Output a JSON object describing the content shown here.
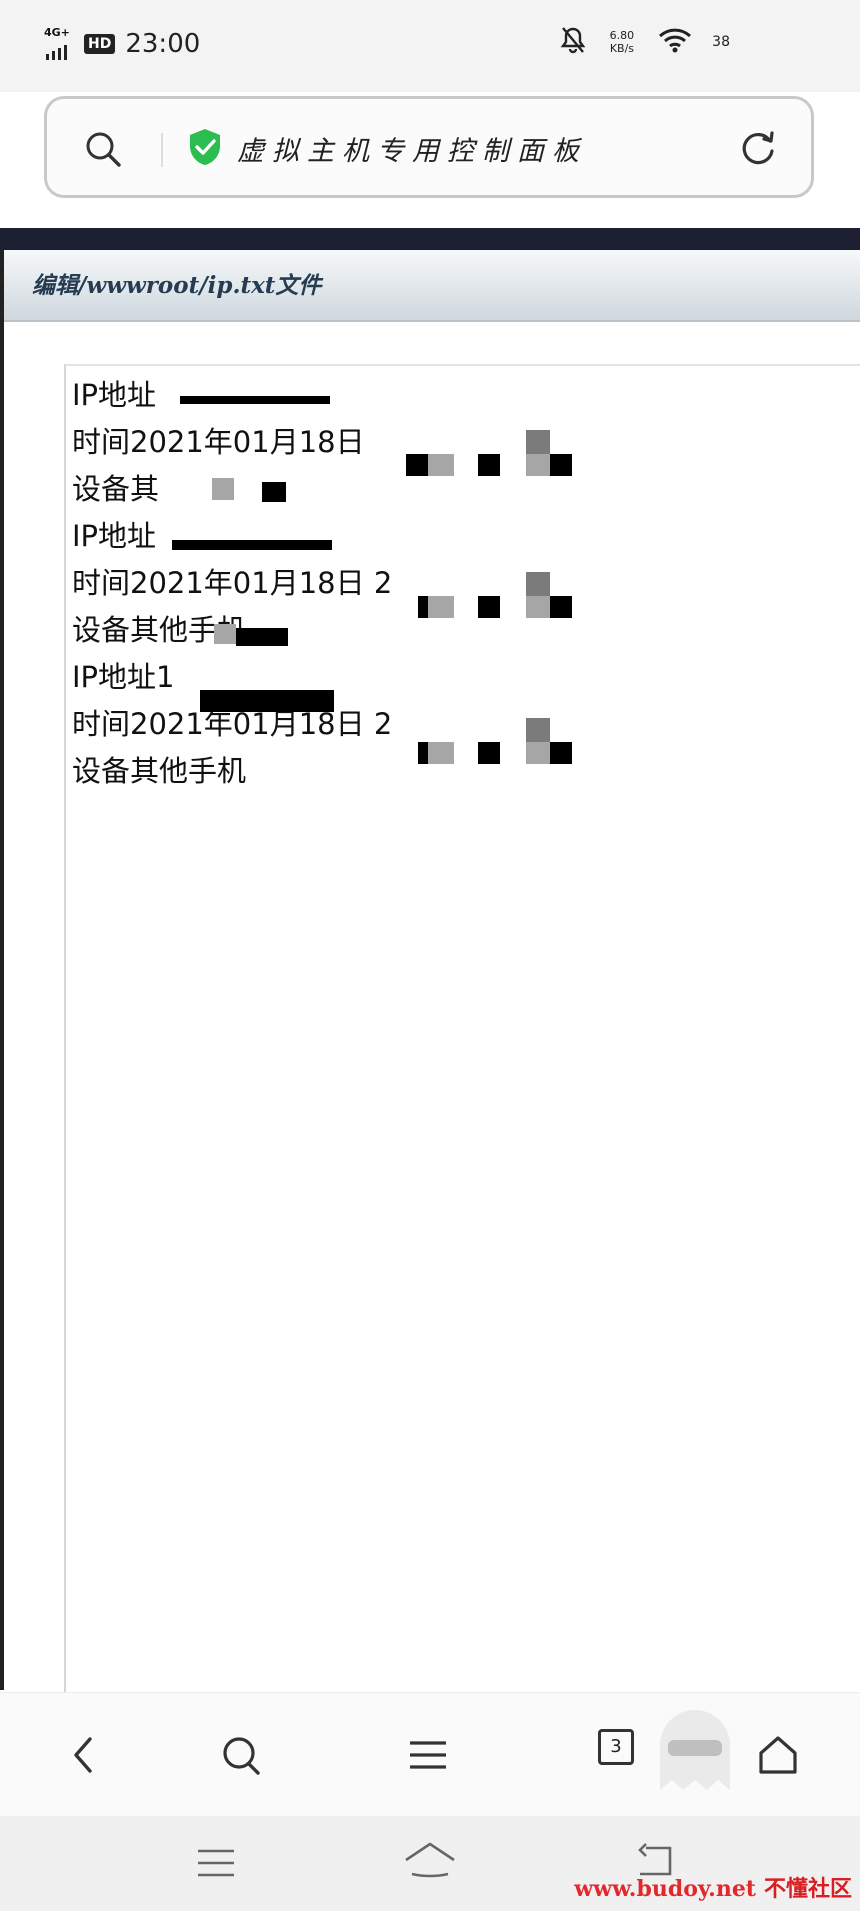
{
  "status_bar": {
    "network": "4G+",
    "hd_badge": "HD",
    "time": "23:00",
    "speed_value": "6.80",
    "speed_unit": "KB/s",
    "battery": "38"
  },
  "address_bar": {
    "page_title": "虚拟主机专用控制面板"
  },
  "page": {
    "heading": "编辑/wwwroot/ip.txt文件",
    "lines": [
      "IP地址",
      "时间2021年01月18日",
      "设备其",
      "IP地址",
      "时间2021年01月18日 2",
      "设备其他手机",
      "IP地址1",
      "时间2021年01月18日 2",
      "设备其他手机"
    ]
  },
  "toolbar": {
    "tab_count": "3"
  },
  "watermark": {
    "site": "www.budoy.net",
    "brand": "不懂社区"
  }
}
